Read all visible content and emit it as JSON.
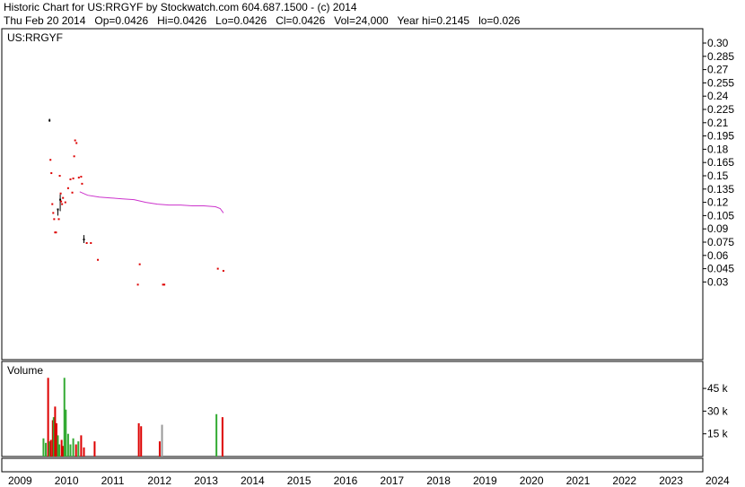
{
  "header": {
    "line1": "Historic Chart for US:RRGYF by Stockwatch.com 604.687.1500 - (c) 2014",
    "line2": "Thu Feb 20 2014   Op=0.0426   Hi=0.0426   Lo=0.0426   Cl=0.0426   Vol=24,000   Year hi=0.2145   lo=0.026"
  },
  "chart_data": {
    "type": "candlestick",
    "symbol_label": "US:RRGYF",
    "volume_label": "Volume",
    "grid": true,
    "price_axis": {
      "position": "right",
      "ticks": [
        "0.30",
        "0.285",
        "0.27",
        "0.255",
        "0.24",
        "0.225",
        "0.21",
        "0.195",
        "0.18",
        "0.165",
        "0.15",
        "0.135",
        "0.12",
        "0.105",
        "0.09",
        "0.075",
        "0.06",
        "0.045",
        "0.03"
      ]
    },
    "volume_axis": {
      "position": "right",
      "ticks": [
        "45 k",
        "30 k",
        "15 k"
      ],
      "tick_values": [
        45000,
        30000,
        15000
      ]
    },
    "x_axis": {
      "years": [
        "2009",
        "2010",
        "2011",
        "2012",
        "2013",
        "2014",
        "2015",
        "2016",
        "2017",
        "2018",
        "2019",
        "2020",
        "2021",
        "2022",
        "2023",
        "2024"
      ]
    },
    "colors": {
      "down": "#dd0000",
      "up": "#000000",
      "moving_average": "#cc33cc",
      "volume_up": "#33aa33",
      "volume_down": "#dd0000",
      "volume_flat": "#999999",
      "grid": "#c8c8c8"
    },
    "price_points": [
      {
        "date": 2009.93,
        "value": 0.2125,
        "hi": 0.2145,
        "lo": 0.211,
        "dir": "up"
      },
      {
        "date": 2009.95,
        "value": 0.168,
        "dir": "down"
      },
      {
        "date": 2009.97,
        "value": 0.153,
        "dir": "down"
      },
      {
        "date": 2009.99,
        "value": 0.118,
        "dir": "down"
      },
      {
        "date": 2010.01,
        "value": 0.108,
        "dir": "down"
      },
      {
        "date": 2010.03,
        "value": 0.101,
        "dir": "down"
      },
      {
        "date": 2010.05,
        "value": 0.086,
        "dir": "down"
      },
      {
        "date": 2010.07,
        "value": 0.086,
        "dir": "down"
      },
      {
        "date": 2010.11,
        "value": 0.112,
        "hi": 0.113,
        "lo": 0.105,
        "dir": "up"
      },
      {
        "date": 2010.13,
        "value": 0.101,
        "dir": "down"
      },
      {
        "date": 2010.15,
        "value": 0.15,
        "dir": "down"
      },
      {
        "date": 2010.16,
        "value": 0.123,
        "hi": 0.129,
        "lo": 0.11,
        "dir": "up"
      },
      {
        "date": 2010.17,
        "value": 0.13,
        "dir": "down"
      },
      {
        "date": 2010.18,
        "value": 0.121,
        "dir": "down"
      },
      {
        "date": 2010.2,
        "value": 0.118,
        "dir": "down"
      },
      {
        "date": 2010.22,
        "value": 0.125,
        "dir": "down"
      },
      {
        "date": 2010.27,
        "value": 0.12,
        "dir": "down"
      },
      {
        "date": 2010.33,
        "value": 0.136,
        "dir": "down"
      },
      {
        "date": 2010.38,
        "value": 0.146,
        "dir": "down"
      },
      {
        "date": 2010.42,
        "value": 0.131,
        "dir": "down"
      },
      {
        "date": 2010.44,
        "value": 0.147,
        "dir": "down"
      },
      {
        "date": 2010.46,
        "value": 0.172,
        "dir": "down"
      },
      {
        "date": 2010.48,
        "value": 0.19,
        "dir": "down"
      },
      {
        "date": 2010.51,
        "value": 0.187,
        "dir": "down"
      },
      {
        "date": 2010.56,
        "value": 0.148,
        "dir": "down"
      },
      {
        "date": 2010.61,
        "value": 0.149,
        "dir": "down"
      },
      {
        "date": 2010.63,
        "value": 0.141,
        "dir": "down"
      },
      {
        "date": 2010.67,
        "value": 0.078,
        "hi": 0.083,
        "lo": 0.074,
        "dir": "up"
      },
      {
        "date": 2010.73,
        "value": 0.074,
        "dir": "down"
      },
      {
        "date": 2010.82,
        "value": 0.074,
        "dir": "down"
      },
      {
        "date": 2010.97,
        "value": 0.055,
        "dir": "down"
      },
      {
        "date": 2011.87,
        "value": 0.05,
        "dir": "down"
      },
      {
        "date": 2011.83,
        "value": 0.027,
        "dir": "down"
      },
      {
        "date": 2012.37,
        "value": 0.027,
        "dir": "down"
      },
      {
        "date": 2012.4,
        "value": 0.027,
        "dir": "down"
      },
      {
        "date": 2013.55,
        "value": 0.045,
        "dir": "down"
      },
      {
        "date": 2013.67,
        "value": 0.0426,
        "dir": "down"
      }
    ],
    "moving_average": {
      "x": [
        2010.58,
        2010.75,
        2011.0,
        2011.25,
        2011.5,
        2011.75,
        2012.0,
        2012.25,
        2012.5,
        2012.75,
        2013.0,
        2013.25,
        2013.5,
        2013.6,
        2013.67
      ],
      "y": [
        0.132,
        0.128,
        0.126,
        0.125,
        0.124,
        0.123,
        0.12,
        0.118,
        0.117,
        0.117,
        0.116,
        0.116,
        0.115,
        0.113,
        0.108
      ]
    },
    "volume_bars": [
      {
        "date": 2009.8,
        "value": 12000,
        "dir": "up"
      },
      {
        "date": 2009.85,
        "value": 9000,
        "dir": "up"
      },
      {
        "date": 2009.9,
        "value": 52000,
        "dir": "down"
      },
      {
        "date": 2009.93,
        "value": 10000,
        "dir": "up"
      },
      {
        "date": 2009.96,
        "value": 11000,
        "dir": "down"
      },
      {
        "date": 2010.0,
        "value": 24000,
        "dir": "down"
      },
      {
        "date": 2010.02,
        "value": 26000,
        "dir": "up"
      },
      {
        "date": 2010.05,
        "value": 33000,
        "dir": "down"
      },
      {
        "date": 2010.08,
        "value": 22000,
        "dir": "down"
      },
      {
        "date": 2010.11,
        "value": 14000,
        "dir": "up"
      },
      {
        "date": 2010.14,
        "value": 8000,
        "dir": "up"
      },
      {
        "date": 2010.19,
        "value": 11000,
        "dir": "down"
      },
      {
        "date": 2010.22,
        "value": 7000,
        "dir": "down"
      },
      {
        "date": 2010.25,
        "value": 52000,
        "dir": "up"
      },
      {
        "date": 2010.28,
        "value": 31000,
        "dir": "up"
      },
      {
        "date": 2010.33,
        "value": 15000,
        "dir": "up"
      },
      {
        "date": 2010.38,
        "value": 8000,
        "dir": "up"
      },
      {
        "date": 2010.44,
        "value": 12000,
        "dir": "up"
      },
      {
        "date": 2010.5,
        "value": 8000,
        "dir": "down"
      },
      {
        "date": 2010.55,
        "value": 10000,
        "dir": "up"
      },
      {
        "date": 2010.61,
        "value": 14000,
        "dir": "down"
      },
      {
        "date": 2010.67,
        "value": 6000,
        "dir": "down"
      },
      {
        "date": 2010.9,
        "value": 10000,
        "dir": "down"
      },
      {
        "date": 2011.85,
        "value": 22000,
        "dir": "down"
      },
      {
        "date": 2011.9,
        "value": 20000,
        "dir": "down"
      },
      {
        "date": 2012.3,
        "value": 10000,
        "dir": "down"
      },
      {
        "date": 2012.35,
        "value": 21000,
        "dir": "flat"
      },
      {
        "date": 2013.52,
        "value": 28000,
        "dir": "up"
      },
      {
        "date": 2013.65,
        "value": 26000,
        "dir": "down"
      }
    ]
  }
}
